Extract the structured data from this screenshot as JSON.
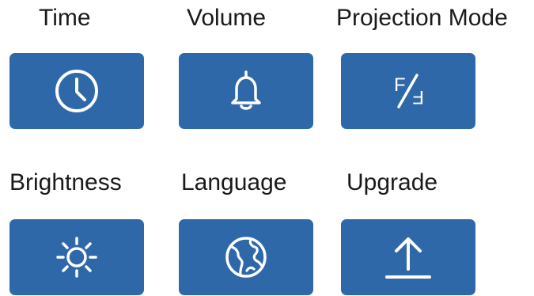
{
  "colors": {
    "tile": "#2f68a8",
    "icon": "#ffffff",
    "label": "#1a1a1a"
  },
  "items": [
    {
      "label": "Time",
      "icon": "clock-icon"
    },
    {
      "label": "Volume",
      "icon": "bell-icon"
    },
    {
      "label": "Projection Mode",
      "icon": "projection-mode-icon"
    },
    {
      "label": "Brightness",
      "icon": "sun-icon"
    },
    {
      "label": "Language",
      "icon": "globe-icon"
    },
    {
      "label": "Upgrade",
      "icon": "upload-icon"
    }
  ],
  "projection_icon": {
    "glyph_top": "F",
    "glyph_bottom": "F"
  }
}
